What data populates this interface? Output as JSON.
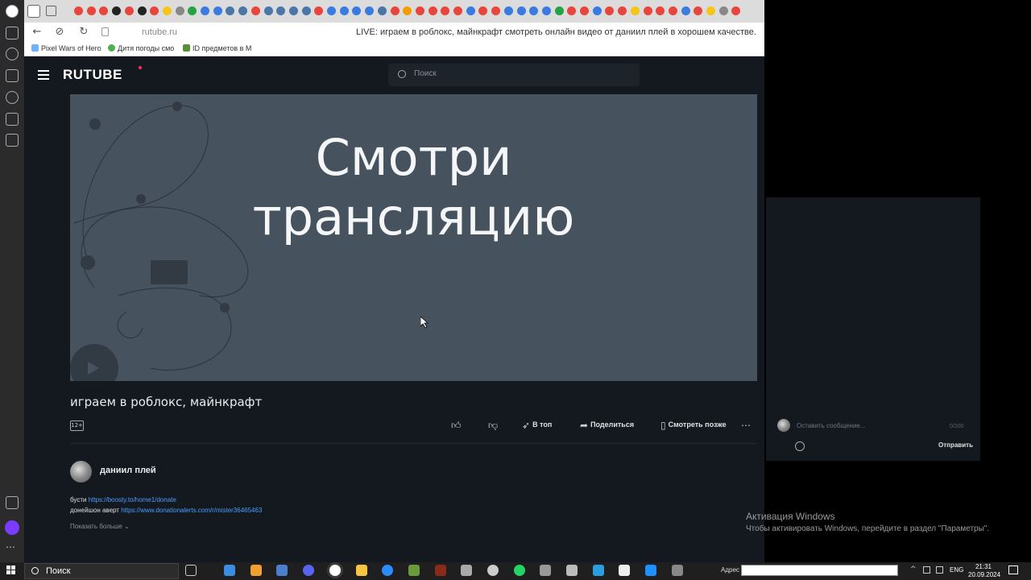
{
  "browser": {
    "url": "rutube.ru",
    "page_title": "LIVE: играем в роблокс, майнкрафт смотреть онлайн видео от даниил плей в хорошем качестве.",
    "bookmarks": [
      {
        "label": "Pixel Wars of Hero",
        "color": "#6fb1ff"
      },
      {
        "label": "Дитя погоды смо",
        "color": "#4fae4f"
      },
      {
        "label": "ID предметов в M",
        "color": "#5a8f3a"
      }
    ]
  },
  "rutube": {
    "logo": "RUTUBE",
    "search_placeholder": "Поиск"
  },
  "player": {
    "overlay_line1": "Смотри",
    "overlay_line2": "трансляцию"
  },
  "video": {
    "title": "играем в роблокс, майнкрафт",
    "age_rating": "12+",
    "actions": {
      "like_icon": "thumb-up-icon",
      "dislike_icon": "thumb-down-icon",
      "top_label": "В топ",
      "share_label": "Поделиться",
      "watch_later_label": "Смотреть позже",
      "more_icon": "more-dots-icon"
    }
  },
  "channel": {
    "name": "даниил плей",
    "description": [
      {
        "prefix": "бусти",
        "link": "https://boosty.to/home1/donate"
      },
      {
        "prefix": "донейшон аверт",
        "link": "https://www.donationalerts.com/r/mister36465463"
      }
    ],
    "show_more": "Показать больше"
  },
  "chat": {
    "placeholder": "Оставить сообщение...",
    "counter": "0/200",
    "send_label": "Отправить"
  },
  "windows_activation": {
    "title": "Активация Windows",
    "subtitle": "Чтобы активировать Windows, перейдите в раздел \"Параметры\"."
  },
  "taskbar": {
    "search_label": "Поиск",
    "address_label": "Адрес",
    "lang": "ENG",
    "time": "21:31",
    "date": "20.09.2024"
  }
}
